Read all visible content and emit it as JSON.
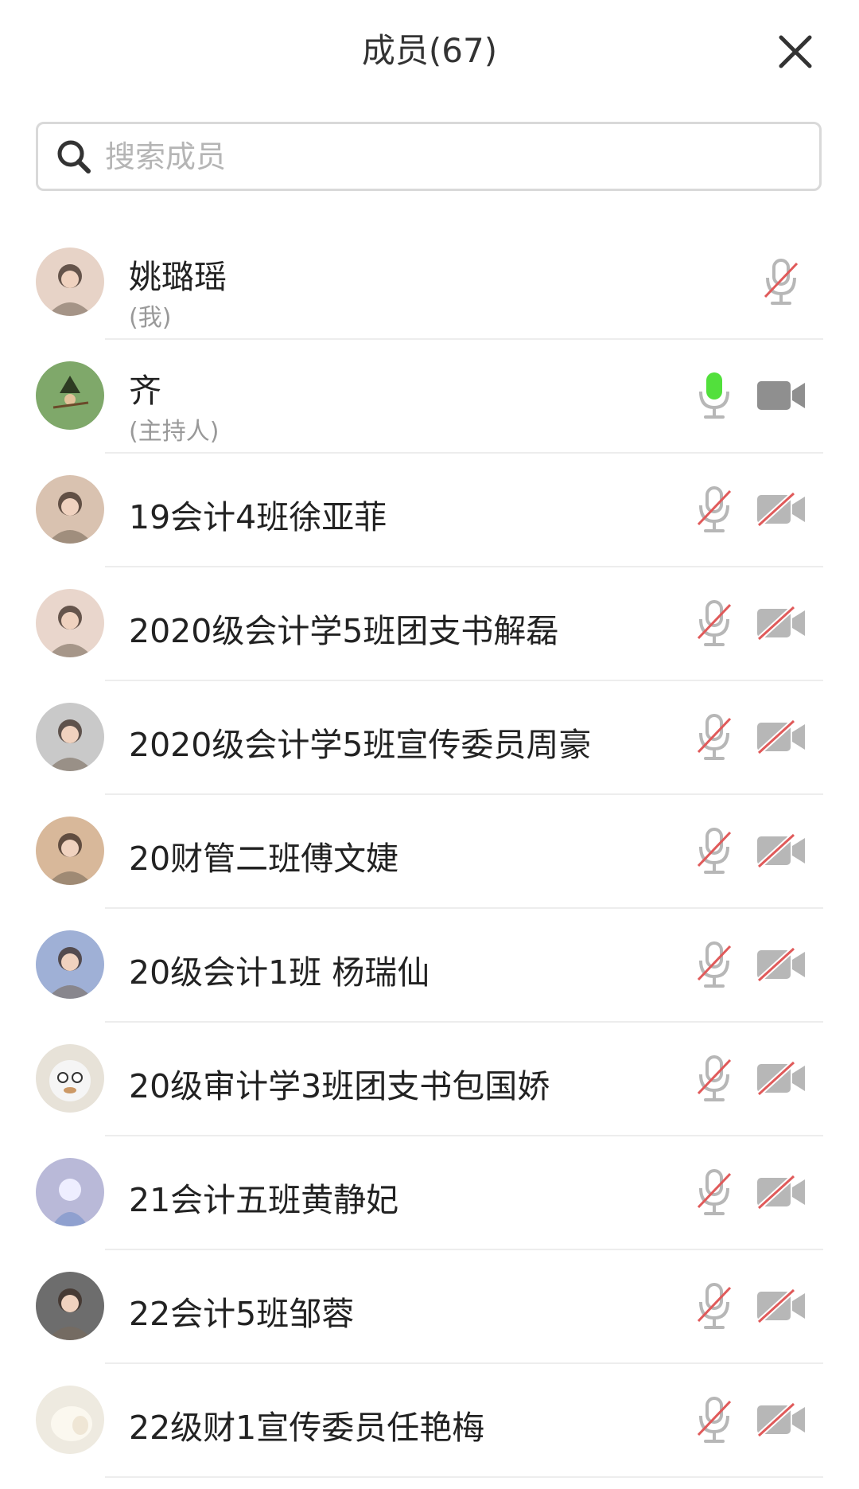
{
  "header": {
    "title": "成员(67)",
    "close_icon": "close-icon"
  },
  "search": {
    "placeholder": "搜索成员",
    "value": ""
  },
  "colors": {
    "muted_red": "#e05a5a",
    "icon_gray": "#b7b7b7",
    "active_green": "#52e03c"
  },
  "members": [
    {
      "name": "姚璐瑶",
      "role": "(我)",
      "mic": "muted",
      "camera": "hidden",
      "avatar": "photo-avatar"
    },
    {
      "name": "齐",
      "role": "(主持人)",
      "mic": "active",
      "camera": "on",
      "avatar": "witch-avatar"
    },
    {
      "name": "19会计4班徐亚菲",
      "role": "",
      "mic": "muted",
      "camera": "off",
      "avatar": "photo-avatar"
    },
    {
      "name": "2020级会计学5班团支书解磊",
      "role": "",
      "mic": "muted",
      "camera": "off",
      "avatar": "photo-avatar"
    },
    {
      "name": "2020级会计学5班宣传委员周豪",
      "role": "",
      "mic": "muted",
      "camera": "off",
      "avatar": "photo-avatar"
    },
    {
      "name": "20财管二班傅文婕",
      "role": "",
      "mic": "muted",
      "camera": "off",
      "avatar": "photo-avatar"
    },
    {
      "name": "20级会计1班 杨瑞仙",
      "role": "",
      "mic": "muted",
      "camera": "off",
      "avatar": "photo-avatar"
    },
    {
      "name": "20级审计学3班团支书包国娇",
      "role": "",
      "mic": "muted",
      "camera": "off",
      "avatar": "cartoon-avatar"
    },
    {
      "name": "21会计五班黄静妃",
      "role": "",
      "mic": "muted",
      "camera": "off",
      "avatar": "illustration-avatar"
    },
    {
      "name": "22会计5班邹蓉",
      "role": "",
      "mic": "muted",
      "camera": "off",
      "avatar": "photo-avatar"
    },
    {
      "name": "22级财1宣传委员任艳梅",
      "role": "",
      "mic": "muted",
      "camera": "off",
      "avatar": "sheep-avatar"
    }
  ]
}
